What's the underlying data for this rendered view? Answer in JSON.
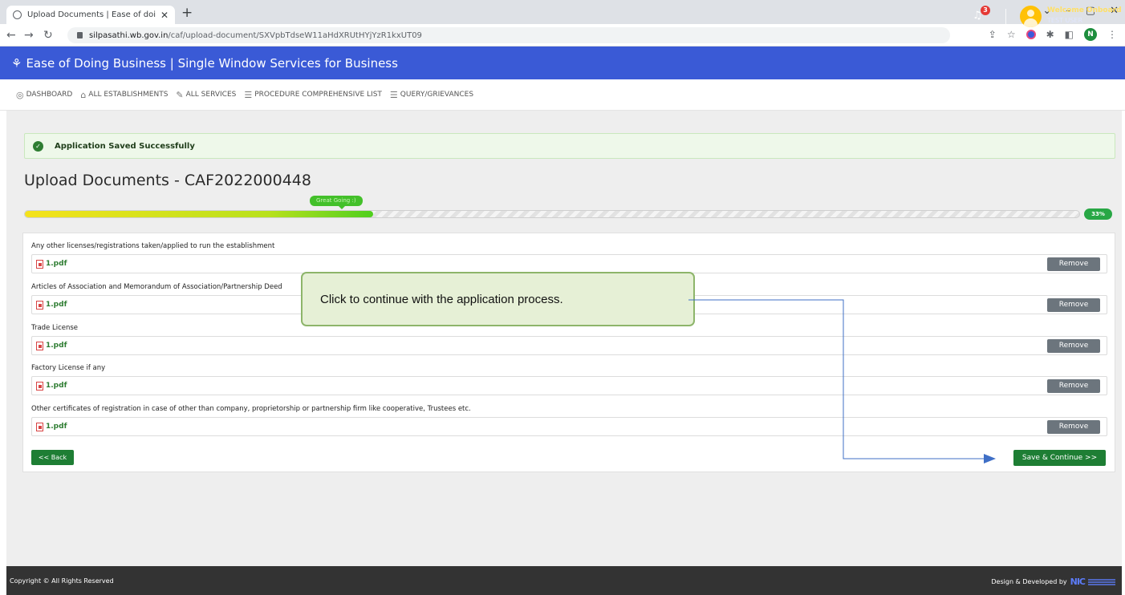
{
  "browser": {
    "tab_title": "Upload Documents | Ease of doin",
    "tab_close": "✕",
    "new_tab": "+",
    "url_host": "silpasathi.wb.gov.in",
    "url_path": "/caf/upload-document/SXVpbTdseW11aHdXRUtHYjYzR1kxUT09",
    "profile_initial": "N"
  },
  "header": {
    "title": "Ease of Doing Business | Single Window Services for Business",
    "notification_count": "3",
    "welcome": "Welcome Onboard",
    "user": "TEST USER",
    "accent_color": "#3a5ad6"
  },
  "nav": {
    "items": [
      {
        "label": "DASHBOARD",
        "icon": "dashboard-icon"
      },
      {
        "label": "ALL ESTABLISHMENTS",
        "icon": "building-icon"
      },
      {
        "label": "ALL SERVICES",
        "icon": "wrench-icon"
      },
      {
        "label": "PROCEDURE COMPREHENSIVE LIST",
        "icon": "list-icon"
      },
      {
        "label": "QUERY/GRIEVANCES",
        "icon": "message-icon"
      }
    ]
  },
  "alert": {
    "message": "Application Saved Successfully"
  },
  "page": {
    "title": "Upload Documents - CAF2022000448"
  },
  "progress": {
    "tooltip": "Great Going :)",
    "percent_label": "33%",
    "fraction": 0.33
  },
  "documents": [
    {
      "label": "Any other licenses/registrations taken/applied to run the establishment",
      "file": "1.pdf",
      "action": "Remove"
    },
    {
      "label": "Articles of Association and Memorandum of Association/Partnership Deed",
      "file": "1.pdf",
      "action": "Remove"
    },
    {
      "label": "Trade License",
      "file": "1.pdf",
      "action": "Remove"
    },
    {
      "label": "Factory License if any",
      "file": "1.pdf",
      "action": "Remove"
    },
    {
      "label": "Other certificates of registration in case of other than company, proprietorship or partnership firm like cooperative, Trustees etc.",
      "file": "1.pdf",
      "action": "Remove"
    }
  ],
  "actions": {
    "back": "<< Back",
    "save": "Save & Continue >>"
  },
  "callout": {
    "text": "Click to continue with the application process."
  },
  "footer": {
    "copyright": "Copyright © All Rights Reserved",
    "designed_by": "Design & Developed by",
    "logo_text": "NIC"
  }
}
